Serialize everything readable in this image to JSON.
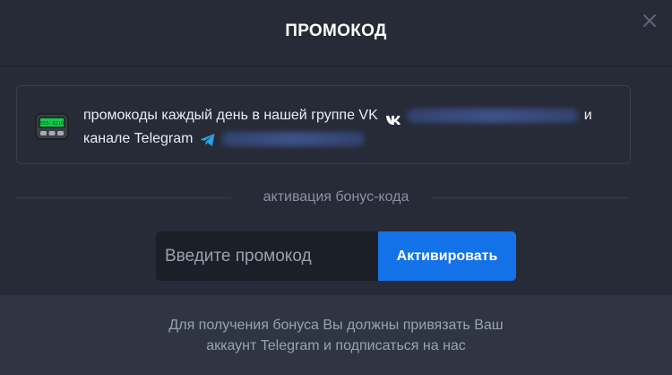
{
  "modal": {
    "title": "ПРОМОКОД",
    "close_icon": "close-icon"
  },
  "info": {
    "icon": "pager-icon",
    "pager_display": "555-3210",
    "line1": "промокоды каждый день в нашей группе VK",
    "vk_icon": "vk-icon",
    "line1_tail": "и",
    "line2": "канале Telegram",
    "tg_icon": "telegram-icon"
  },
  "divider": {
    "label": "активация бонус-кода"
  },
  "promo": {
    "placeholder": "Введите промокод",
    "value": "",
    "button_label": "Активировать"
  },
  "footer": {
    "line1": "Для получения бонуса Вы должны привязать Ваш",
    "line2": "аккаунт Telegram и подписаться на нас"
  },
  "colors": {
    "background": "#262b37",
    "footer_bg": "#2f3542",
    "accent": "#1472e8",
    "input_bg": "#1b1f28",
    "muted_text": "#9aa1b0",
    "telegram": "#2aa3e6"
  }
}
